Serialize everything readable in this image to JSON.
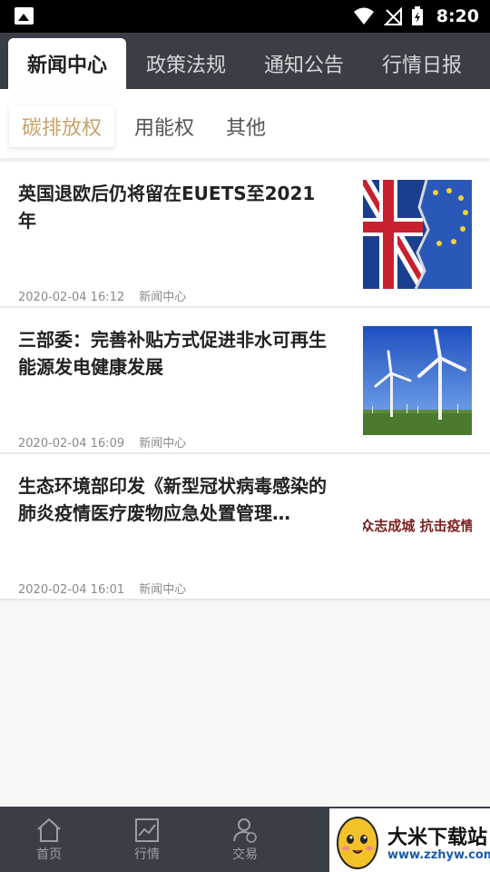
{
  "status_bar": {
    "time": "8:20",
    "icons": [
      "image-icon",
      "wifi-icon",
      "no-signal-icon",
      "battery-charging-icon"
    ]
  },
  "top_tabs": [
    {
      "label": "新闻中心",
      "active": true
    },
    {
      "label": "政策法规",
      "active": false
    },
    {
      "label": "通知公告",
      "active": false
    },
    {
      "label": "行情日报",
      "active": false
    }
  ],
  "sub_tabs": [
    {
      "label": "碳排放权",
      "active": true
    },
    {
      "label": "用能权",
      "active": false
    },
    {
      "label": "其他",
      "active": false
    }
  ],
  "news": [
    {
      "title": "英国退欧后仍将留在EUETS至2021年",
      "date": "2020-02-04 16:12",
      "category": "新闻中心",
      "thumb": "uk-eu-flag-image"
    },
    {
      "title": "三部委：完善补贴方式促进非水可再生能源发电健康发展",
      "date": "2020-02-04 16:09",
      "category": "新闻中心",
      "thumb": "wind-turbines-image"
    },
    {
      "title": "生态环境部印发《新型冠状病毒感染的肺炎疫情医疗废物应急处置管理…",
      "date": "2020-02-04 16:01",
      "category": "新闻中心",
      "thumb": "calligraphy-image",
      "thumb_text": "众志成城 抗击疫情"
    }
  ],
  "bottom_nav": [
    {
      "label": "首页",
      "icon": "home-icon"
    },
    {
      "label": "行情",
      "icon": "chart-icon"
    },
    {
      "label": "交易",
      "icon": "trade-user-icon"
    }
  ],
  "watermark": {
    "text1": "大米下载站",
    "text2": "www.zzhyw.com"
  },
  "colors": {
    "dark_bar": "#3a3f47",
    "accent_gold": "#c9a36a",
    "text_dark": "#222222",
    "meta_gray": "#8a8a8a"
  }
}
